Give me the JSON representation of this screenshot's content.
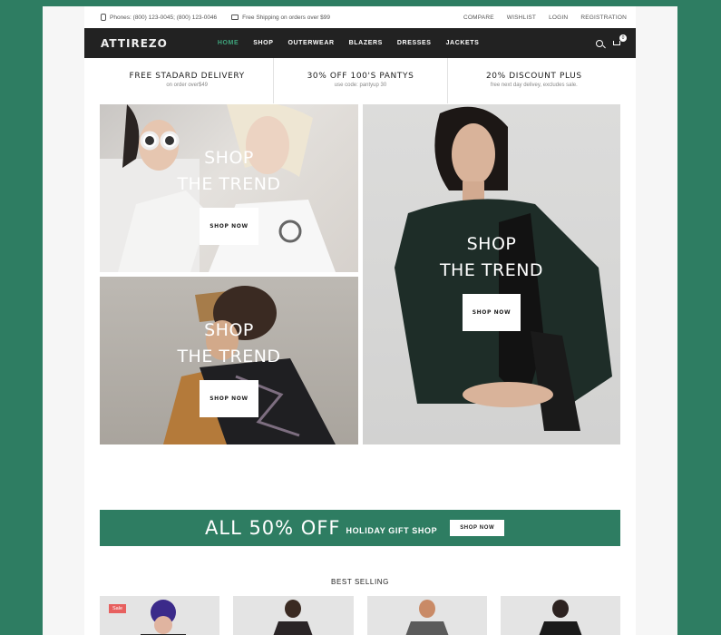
{
  "topbar": {
    "phones": "Phones: (800) 123-0045; (800) 123-0046",
    "shipping": "Free Shipping on orders over $99",
    "links": [
      "COMPARE",
      "WISHLIST",
      "LOGIN",
      "REGISTRATION"
    ]
  },
  "navbar": {
    "logo": "ATTIREZO",
    "items": [
      "HOME",
      "SHOP",
      "OUTERWEAR",
      "BLAZERS",
      "DRESSES",
      "JACKETS"
    ],
    "active": "HOME",
    "cart_count": "0"
  },
  "promos": [
    {
      "title": "FREE STADARD DELIVERY",
      "subtitle": "on order over$49"
    },
    {
      "title": "30% OFF 100'S PANTYS",
      "subtitle": "use code: pantyup 30"
    },
    {
      "title": "20% DISCOUNT PLUS",
      "subtitle": "free next day delivey, excludes sale."
    }
  ],
  "banners": [
    {
      "line1": "SHOP",
      "line2": "THE TREND",
      "button": "SHOP NOW"
    },
    {
      "line1": "SHOP",
      "line2": "THE TREND",
      "button": "SHOP NOW"
    },
    {
      "line1": "SHOP",
      "line2": "THE TREND",
      "button": "SHOP NOW"
    }
  ],
  "sale_banner": {
    "headline": "ALL 50% OFF",
    "sub": "HOLIDAY GIFT SHOP",
    "button": "SHOP NOW"
  },
  "best_selling": {
    "title": "BEST SELLING",
    "badge": "Sale"
  },
  "colors": {
    "accent": "#2e7d62",
    "nav_bg": "#222222",
    "active_nav": "#3fa37c",
    "sale_badge": "#e7605f"
  }
}
